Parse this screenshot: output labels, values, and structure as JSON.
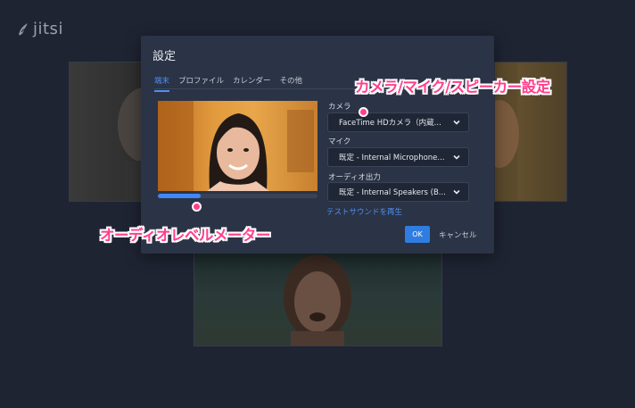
{
  "app": {
    "logo_text": "jitsi"
  },
  "dialog": {
    "title": "設定",
    "tabs": [
      {
        "label": "端末",
        "active": true
      },
      {
        "label": "プロファイル",
        "active": false
      },
      {
        "label": "カレンダー",
        "active": false
      },
      {
        "label": "その他",
        "active": false
      }
    ],
    "audio_level": 0.27,
    "camera": {
      "label": "カメラ",
      "value": "FaceTime HDカメラ（内蔵..."
    },
    "microphone": {
      "label": "マイク",
      "value": "既定 - Internal Microphone..."
    },
    "audio_output": {
      "label": "オーディオ出力",
      "value": "既定 - Internal Speakers (B..."
    },
    "test_sound_link": "テストサウンドを再生",
    "ok_label": "OK",
    "cancel_label": "キャンセル"
  },
  "annotations": {
    "devices": "カメラ/マイク/スピーカー設定",
    "meter": "オーディオレベルメーター"
  },
  "colors": {
    "background": "#1f2433",
    "dialog": "#2b3346",
    "accent": "#4f8ff0",
    "annotation": "#ff3f8c"
  },
  "icons": [
    "jitsi-logo-icon",
    "chevron-down-icon"
  ]
}
